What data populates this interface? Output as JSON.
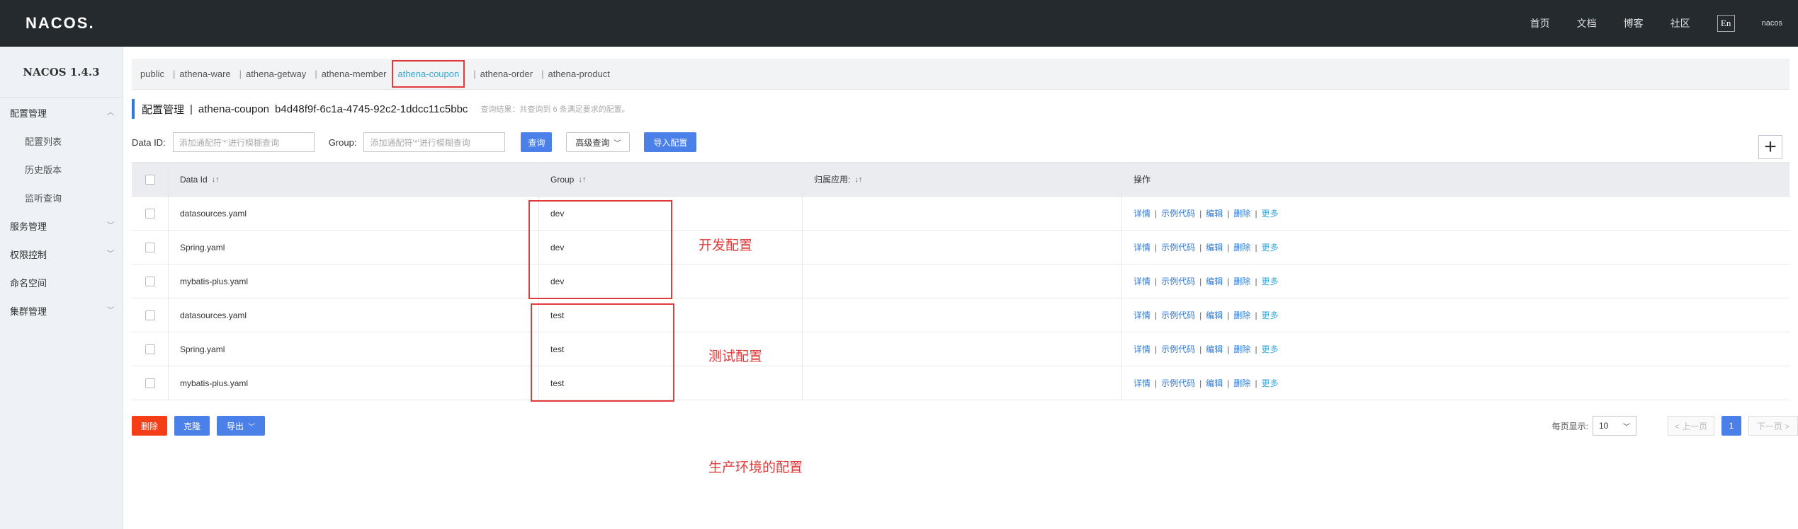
{
  "header": {
    "logo": "NACOS.",
    "nav": [
      "首页",
      "文档",
      "博客",
      "社区"
    ],
    "lang": "En",
    "user": "nacos"
  },
  "sidebar": {
    "version": "NACOS 1.4.3",
    "items": [
      {
        "label": "配置管理",
        "chevron": "up"
      },
      {
        "label": "配置列表",
        "sub": true
      },
      {
        "label": "历史版本",
        "sub": true
      },
      {
        "label": "监听查询",
        "sub": true
      },
      {
        "label": "服务管理",
        "chevron": "down"
      },
      {
        "label": "权限控制",
        "chevron": "down"
      },
      {
        "label": "命名空间"
      },
      {
        "label": "集群管理",
        "chevron": "down"
      }
    ]
  },
  "namespaces": [
    "public",
    "athena-ware",
    "athena-getway",
    "athena-member",
    "athena-coupon",
    "athena-order",
    "athena-product"
  ],
  "active_namespace": "athena-coupon",
  "title": {
    "prefix": "配置管理",
    "separator": "|",
    "namespace": "athena-coupon",
    "namespace_id": "b4d48f9f-6c1a-4745-92c2-1ddcc11c5bbc",
    "hint": "查询结果：共查询到 6 条满足要求的配置。"
  },
  "filters": {
    "data_id_label": "Data ID:",
    "data_id_placeholder": "添加通配符'*'进行模糊查询",
    "group_label": "Group:",
    "group_placeholder": "添加通配符'*'进行模糊查询",
    "search_btn": "查询",
    "advanced_btn": "高级查询",
    "import_btn": "导入配置",
    "add_btn": "+"
  },
  "table": {
    "headers": [
      "Data Id",
      "Group",
      "归属应用:",
      "操作"
    ],
    "rows": [
      {
        "data_id": "datasources.yaml",
        "group": "dev",
        "app": ""
      },
      {
        "data_id": "Spring.yaml",
        "group": "dev",
        "app": ""
      },
      {
        "data_id": "mybatis-plus.yaml",
        "group": "dev",
        "app": ""
      },
      {
        "data_id": "datasources.yaml",
        "group": "test",
        "app": ""
      },
      {
        "data_id": "Spring.yaml",
        "group": "test",
        "app": ""
      },
      {
        "data_id": "mybatis-plus.yaml",
        "group": "test",
        "app": ""
      }
    ],
    "operations": [
      "详情",
      "示例代码",
      "编辑",
      "删除",
      "更多"
    ],
    "op_separator": "|"
  },
  "annotations": {
    "dev": "开发配置",
    "test": "测试配置",
    "prod": "生产环境的配置"
  },
  "bottom": {
    "delete_btn": "删除",
    "clone_btn": "克隆",
    "export_btn": "导出",
    "page_size_label": "每页显示:",
    "page_size": "10",
    "prev": "< 上一页",
    "current_page": "1",
    "next": "下一页 >"
  },
  "colors": {
    "header_bg": "#252a2f",
    "primary": "#4a80e8",
    "link": "#2f7ad8",
    "danger": "#f53d17",
    "annotation": "#e23b3b"
  }
}
